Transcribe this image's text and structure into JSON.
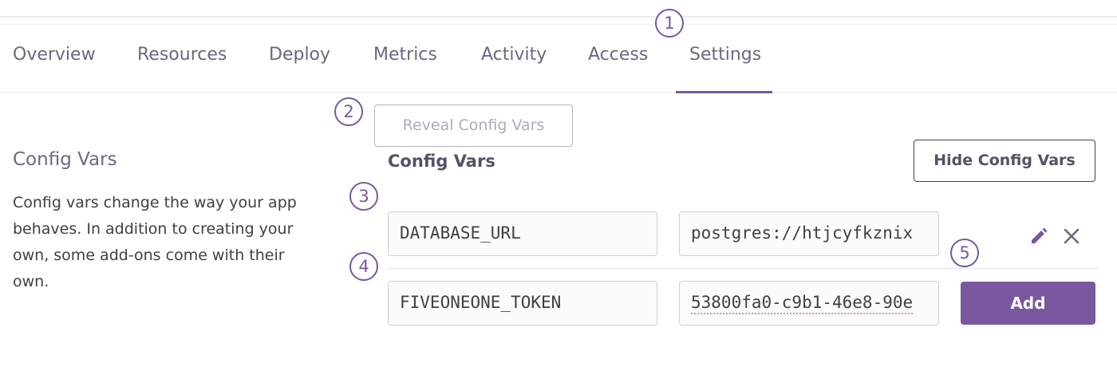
{
  "nav": {
    "tabs": [
      {
        "label": "Overview"
      },
      {
        "label": "Resources"
      },
      {
        "label": "Deploy"
      },
      {
        "label": "Metrics"
      },
      {
        "label": "Activity"
      },
      {
        "label": "Access"
      },
      {
        "label": "Settings",
        "active": true
      }
    ]
  },
  "steps": [
    "1",
    "2",
    "3",
    "4",
    "5"
  ],
  "reveal_button": "Reveal Config Vars",
  "sidebar": {
    "title": "Config Vars",
    "description": "Config vars change the way your app behaves. In addition to creating your own, some add-ons come with their own."
  },
  "config": {
    "heading": "Config Vars",
    "hide_button": "Hide Config Vars",
    "rows": [
      {
        "key": "DATABASE_URL",
        "value": "postgres://htjcyfkznix"
      },
      {
        "key": "FIVEONEONE_TOKEN",
        "value": "53800fa0-c9b1-46e8-90e"
      }
    ],
    "add_button": "Add"
  },
  "colors": {
    "accent": "#79589f",
    "text": "#3f3f44",
    "muted": "#6c6880"
  },
  "icons": [
    "edit-pencil-icon",
    "delete-x-icon"
  ]
}
